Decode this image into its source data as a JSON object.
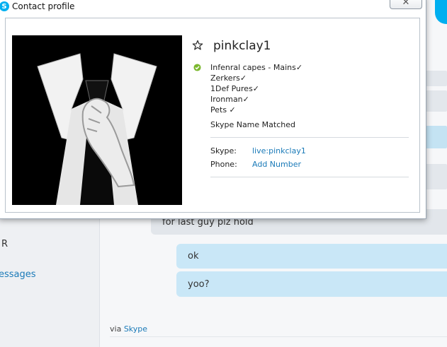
{
  "window": {
    "title": "Contact profile",
    "close_glyph": "✕"
  },
  "contact": {
    "name": "pinkclay1",
    "status": "online",
    "mood_lines": [
      "Infenral capes - Mains✓",
      "Zerkers✓",
      "1Def Pures✓",
      "Ironman✓",
      "Pets ✓"
    ],
    "match_note": "Skype Name Matched",
    "fields": {
      "skype_label": "Skype:",
      "skype_value": "live:pinkclay1",
      "phone_label": "Phone:",
      "phone_value": "Add Number"
    }
  },
  "background": {
    "sidebar_partial_text": "R",
    "sidebar_messages_partial": "essages",
    "chat": {
      "partial_message": "for last guy plz hold",
      "messages": [
        "ok",
        "yoo?"
      ],
      "via_prefix": "via",
      "via_link": "Skype"
    }
  },
  "colors": {
    "skype_blue": "#00aff0",
    "link": "#1a7ab8",
    "bubble_sent": "#c9e7f7",
    "status_online": "#7cb82f"
  },
  "icons": {
    "logo": "skype-logo-icon",
    "favorite": "star-outline-icon",
    "status": "online-check-icon",
    "close": "close-icon"
  }
}
